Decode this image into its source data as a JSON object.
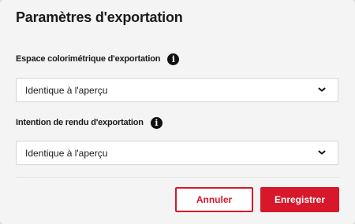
{
  "dialog": {
    "title": "Paramètres d'exportation"
  },
  "color_space": {
    "label": "Espace colorimétrique d'exportation",
    "info_icon": "info-icon",
    "value": "Identique à l'aperçu"
  },
  "render_intent": {
    "label": "Intention de rendu d'exportation",
    "info_icon": "info-icon",
    "value": "Identique à l'aperçu"
  },
  "buttons": {
    "cancel_label": "Annuler",
    "save_label": "Enregistrer"
  },
  "colors": {
    "accent": "#d7182a",
    "background": "#f4f4f4"
  }
}
